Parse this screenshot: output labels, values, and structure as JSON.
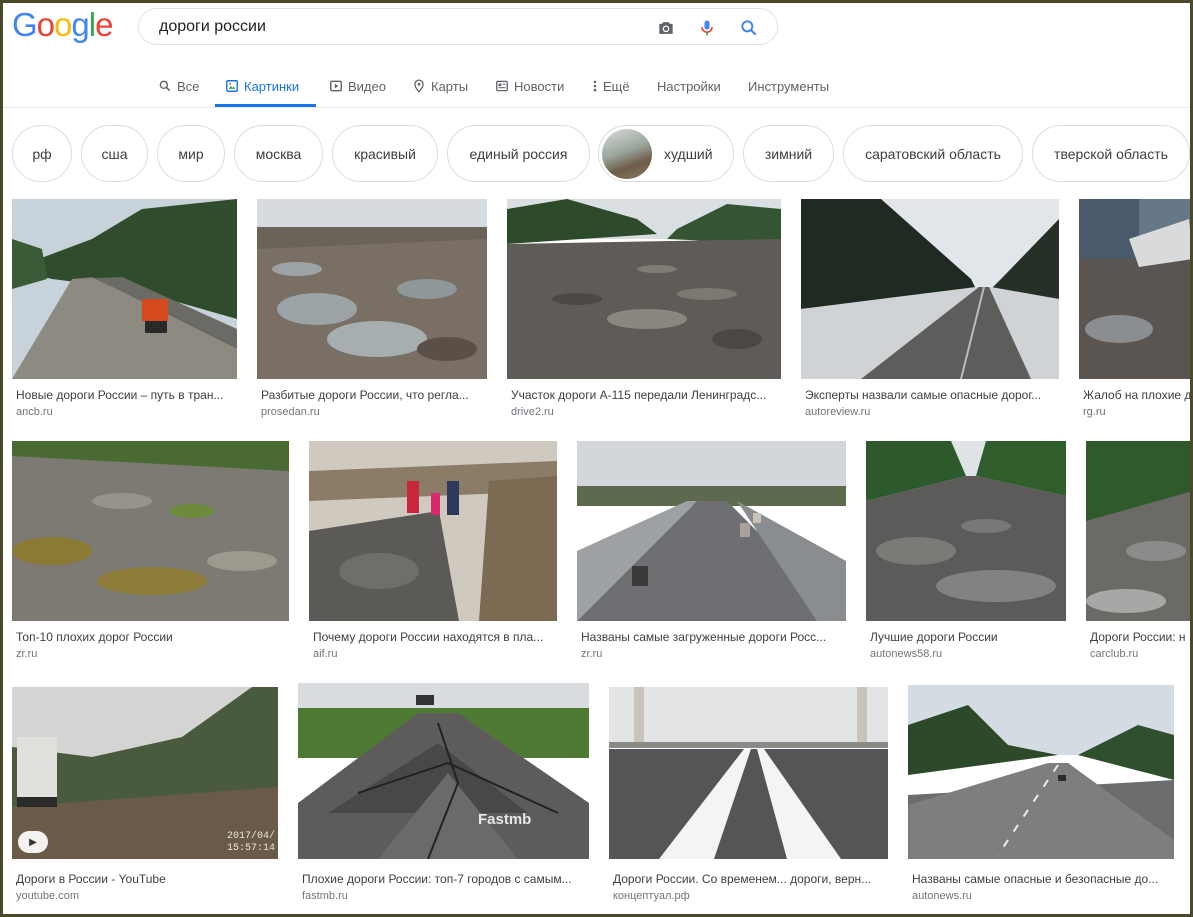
{
  "search": {
    "query": "дороги россии",
    "logo_letters": [
      "G",
      "o",
      "o",
      "g",
      "l",
      "e"
    ],
    "logo_colors": [
      "#4285f4",
      "#ea4335",
      "#fbbc05",
      "#4285f4",
      "#34a853",
      "#ea4335"
    ]
  },
  "tabs": [
    {
      "label": "Все",
      "icon": "search-icon"
    },
    {
      "label": "Картинки",
      "icon": "image-icon",
      "active": true
    },
    {
      "label": "Видео",
      "icon": "play-icon"
    },
    {
      "label": "Карты",
      "icon": "map-pin-icon"
    },
    {
      "label": "Новости",
      "icon": "news-icon"
    },
    {
      "label": "Ещё",
      "icon": "more-vertical-icon"
    },
    {
      "label": "Настройки"
    },
    {
      "label": "Инструменты"
    }
  ],
  "chips": [
    "рф",
    "сша",
    "мир",
    "москва",
    "красивый",
    "единый россия",
    "худший",
    "зимний",
    "саратовский область",
    "тверской область"
  ],
  "results": [
    {
      "title": "Новые дороги России – путь в тран...",
      "source": "ancb.ru"
    },
    {
      "title": "Разбитые дороги России, что регла...",
      "source": "prosedan.ru"
    },
    {
      "title": "Участок дороги А-115 передали Ленинградс...",
      "source": "drive2.ru"
    },
    {
      "title": "Эксперты назвали самые опасные дорог...",
      "source": "autoreview.ru"
    },
    {
      "title": "Жалоб на плохие д",
      "source": "rg.ru"
    },
    {
      "title": "Топ-10 плохих дорог России",
      "source": "zr.ru"
    },
    {
      "title": "Почему дороги России находятся в пла...",
      "source": "aif.ru"
    },
    {
      "title": "Названы самые загруженные дороги Росс...",
      "source": "zr.ru"
    },
    {
      "title": "Лучшие дороги России",
      "source": "autonews58.ru"
    },
    {
      "title": "Дороги России: н",
      "source": "carclub.ru"
    },
    {
      "title": "Дороги в России - YouTube",
      "source": "youtube.com",
      "timestamp": "2017/04/\n15:57:14"
    },
    {
      "title": "Плохие дороги России: топ-7 городов с самым...",
      "source": "fastmb.ru",
      "watermark": "Fastmb"
    },
    {
      "title": "Дороги России. Со временем... дороги, верн...",
      "source": "концептуал.рф"
    },
    {
      "title": "Названы самые опасные и безопасные до...",
      "source": "autonews.ru"
    }
  ],
  "colors": {
    "accent": "#1a73e8",
    "text_secondary": "#70757a",
    "frame": "#4a4a2a"
  }
}
